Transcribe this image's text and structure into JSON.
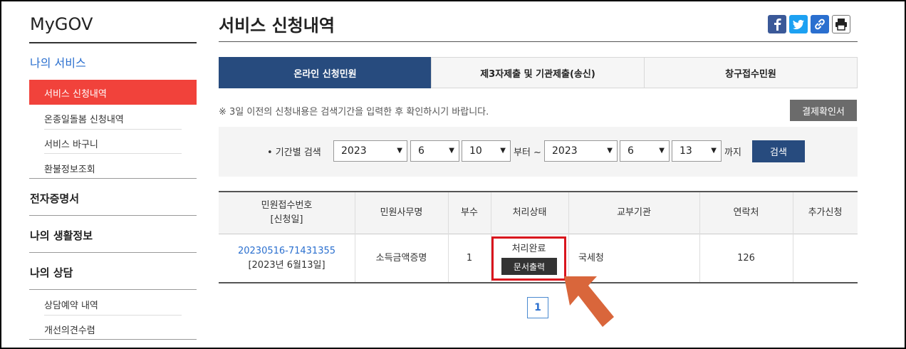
{
  "sidebar": {
    "title": "MyGOV",
    "my_service": "나의 서비스",
    "items": [
      {
        "label": "서비스 신청내역"
      },
      {
        "label": "온종일돌봄 신청내역"
      },
      {
        "label": "서비스 바구니"
      },
      {
        "label": "환불정보조회"
      }
    ],
    "sections": [
      {
        "label": "전자증명서"
      },
      {
        "label": "나의 생활정보"
      },
      {
        "label": "나의 상담"
      }
    ],
    "consult_items": [
      {
        "label": "상담예약 내역"
      },
      {
        "label": "개선의견수렴"
      }
    ]
  },
  "header": {
    "title": "서비스 신청내역",
    "share_icons": [
      "facebook-icon",
      "twitter-icon",
      "link-icon",
      "print-icon"
    ]
  },
  "tabs": [
    {
      "label": "온라인 신청민원"
    },
    {
      "label": "제3자제출 및 기관제출(송신)"
    },
    {
      "label": "창구접수민원"
    }
  ],
  "notice": "※ 3일 이전의 신청내용은 검색기간을 입력한 후 확인하시기 바랍니다.",
  "receipt_button": "결제확인서",
  "search": {
    "label": "• 기간별 검색",
    "from_year": "2023",
    "from_month": "6",
    "from_day": "10",
    "from_text": "부터 ~",
    "to_year": "2023",
    "to_month": "6",
    "to_day": "13",
    "to_text": "까지",
    "button": "검색"
  },
  "table": {
    "headers": {
      "receipt_no": "민원접수번호",
      "receipt_date": "[신청일]",
      "name": "민원사무명",
      "copies": "부수",
      "status": "처리상태",
      "issuer": "교부기관",
      "contact": "연락처",
      "extra": "추가신청"
    },
    "rows": [
      {
        "receipt_no": "20230516-71431355",
        "date": "[2023년 6월13일]",
        "name": "소득금액증명",
        "copies": "1",
        "status": "처리완료",
        "print_button": "문서출력",
        "issuer": "국세청",
        "contact": "126",
        "extra": ""
      }
    ]
  },
  "pagination": {
    "current": "1"
  },
  "colors": {
    "accent_red": "#f1423b",
    "nav_blue": "#274b7e",
    "highlight": "#d9151d",
    "arrow": "#d9663b"
  }
}
